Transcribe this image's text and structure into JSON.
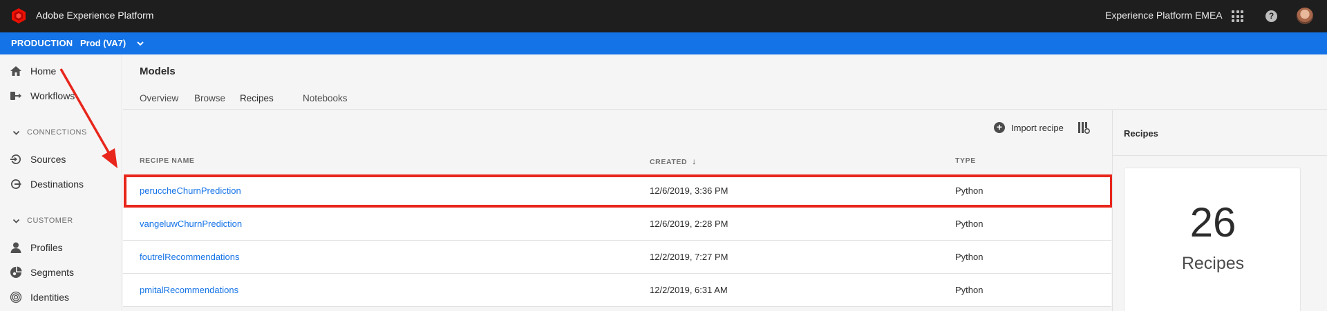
{
  "app": {
    "title": "Adobe Experience Platform",
    "org": "Experience Platform EMEA"
  },
  "env": {
    "label": "PRODUCTION",
    "sandbox": "Prod (VA7)"
  },
  "sidebar": {
    "home": "Home",
    "workflows": "Workflows",
    "connections_header": "CONNECTIONS",
    "sources": "Sources",
    "destinations": "Destinations",
    "customer_header": "CUSTOMER",
    "profiles": "Profiles",
    "segments": "Segments",
    "identities": "Identities"
  },
  "main": {
    "title": "Models",
    "tabs": [
      "Overview",
      "Browse",
      "Recipes",
      "Notebooks"
    ],
    "active_tab": "Recipes"
  },
  "toolbar": {
    "import_label": "Import recipe"
  },
  "table": {
    "headers": {
      "name": "RECIPE NAME",
      "created": "CREATED",
      "type": "TYPE"
    },
    "rows": [
      {
        "name": "peruccheChurnPrediction",
        "created": "12/6/2019, 3:36 PM",
        "type": "Python"
      },
      {
        "name": "vangeluwChurnPrediction",
        "created": "12/6/2019, 2:28 PM",
        "type": "Python"
      },
      {
        "name": "foutrelRecommendations",
        "created": "12/2/2019, 7:27 PM",
        "type": "Python"
      },
      {
        "name": "pmitalRecommendations",
        "created": "12/2/2019, 6:31 AM",
        "type": "Python"
      }
    ]
  },
  "right_panel": {
    "title": "Recipes",
    "count": "26",
    "count_label": "Recipes"
  },
  "colors": {
    "accent": "#1473e6",
    "topbar": "#1e1e1e",
    "highlight": "#e8261c",
    "brand": "#eb1000"
  }
}
